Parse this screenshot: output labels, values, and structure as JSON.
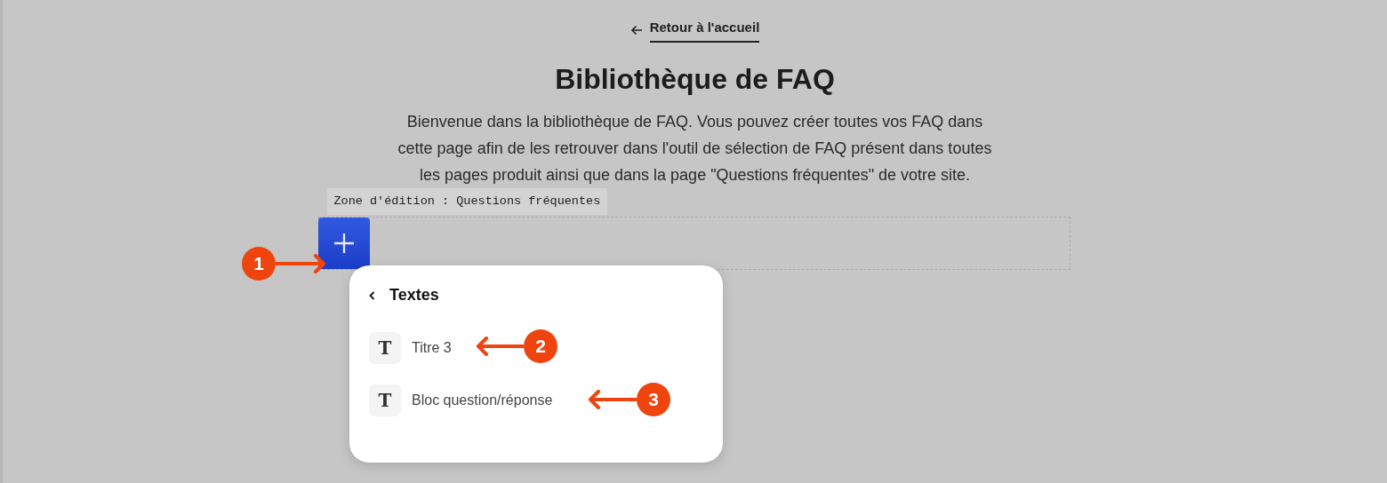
{
  "back_link": {
    "label": "Retour à l'accueil"
  },
  "title": "Bibliothèque de FAQ",
  "intro": "Bienvenue dans la bibliothèque de FAQ. Vous pouvez créer toutes vos FAQ dans cette page afin de les retrouver dans l'outil de sélection de FAQ présent dans toutes les pages produit ainsi que dans la page \"Questions fréquentes\" de votre site.",
  "edit_zone": {
    "label": "Zone d'édition : Questions fréquentes"
  },
  "add_menu": {
    "title": "Textes",
    "items": [
      {
        "label": "Titre 3",
        "icon": "T"
      },
      {
        "label": "Bloc question/réponse",
        "icon": "T"
      }
    ]
  },
  "callouts": [
    "1",
    "2",
    "3"
  ]
}
